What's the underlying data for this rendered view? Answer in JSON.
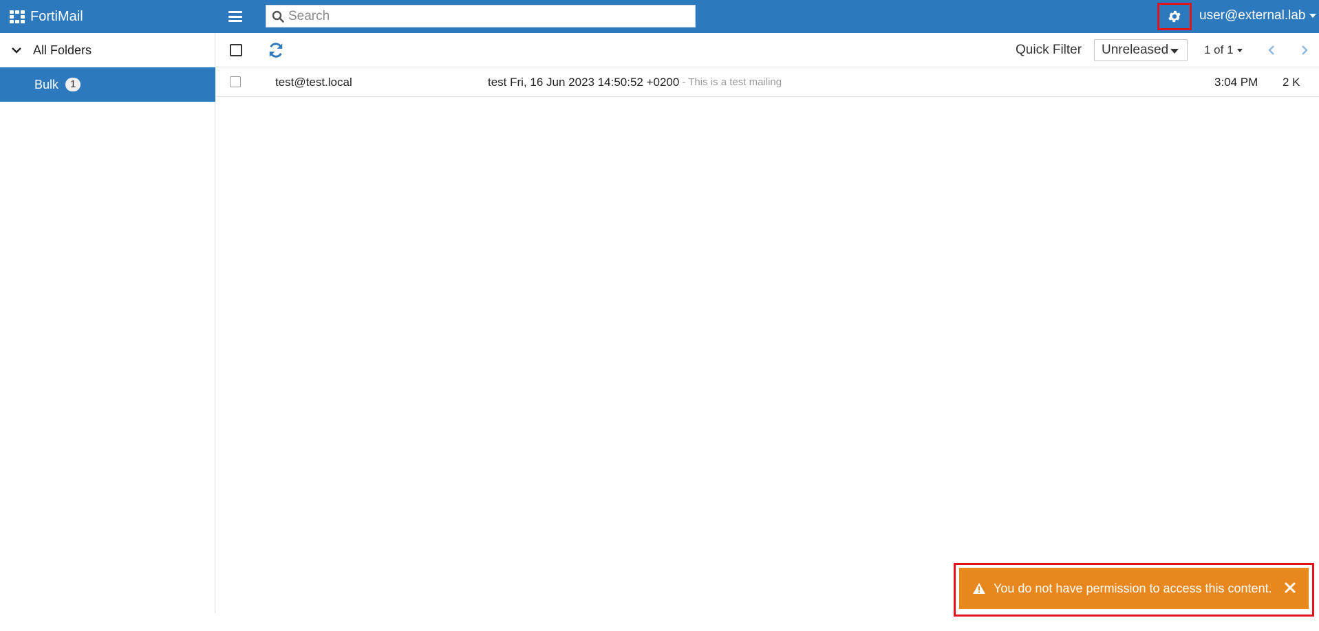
{
  "app": {
    "title": "FortiMail"
  },
  "search": {
    "placeholder": "Search"
  },
  "header": {
    "user": "user@external.lab"
  },
  "sidebar": {
    "root_label": "All Folders",
    "items": [
      {
        "label": "Bulk",
        "count": "1"
      }
    ]
  },
  "toolbar": {
    "quick_filter_label": "Quick Filter",
    "quick_filter_value": "Unreleased",
    "pager": "1 of 1"
  },
  "messages": [
    {
      "from": "test@test.local",
      "subject": "test Fri, 16 Jun 2023 14:50:52 +0200",
      "preview": "- This is a test mailing",
      "time": "3:04 PM",
      "size": "2 K"
    }
  ],
  "toast": {
    "message": "You do not have permission to access this content."
  },
  "colors": {
    "brand_blue": "#2d79bd",
    "toast_orange": "#e8871e",
    "highlight_red": "#e0141e"
  }
}
